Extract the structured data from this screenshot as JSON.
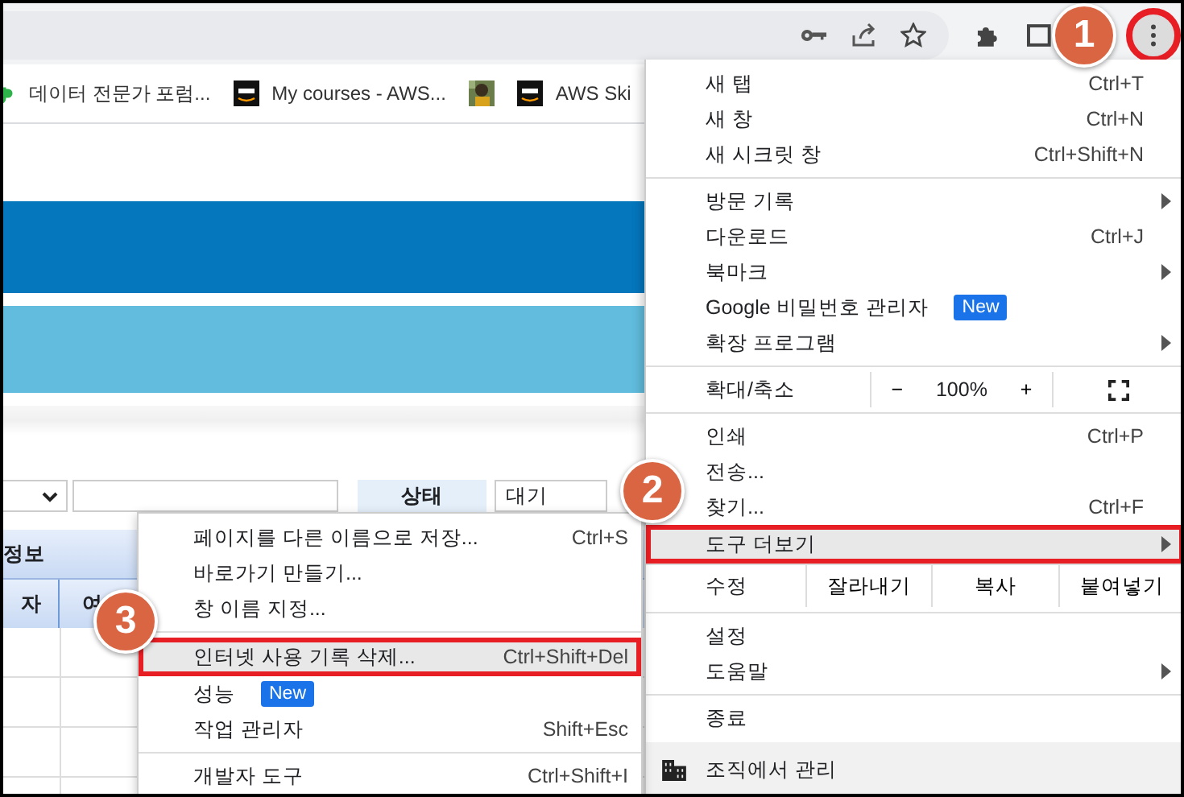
{
  "toolbar": {
    "menu_button": {
      "highlighted": true,
      "callout": "1"
    }
  },
  "bookmarks": [
    {
      "label": "데이터 전문가 포럼..."
    },
    {
      "label": "My courses - AWS..."
    },
    {
      "label": "AWS Ski"
    }
  ],
  "form": {
    "status_header": "상태",
    "status_value": "대기"
  },
  "table": {
    "group_header": "정보",
    "columns": [
      "자",
      "여"
    ]
  },
  "menu": {
    "items": [
      {
        "kind": "item",
        "label": "새 탭",
        "shortcut": "Ctrl+T",
        "submenu": false,
        "selected": false
      },
      {
        "kind": "item",
        "label": "새 창",
        "shortcut": "Ctrl+N",
        "submenu": false,
        "selected": false
      },
      {
        "kind": "item",
        "label": "새 시크릿 창",
        "shortcut": "Ctrl+Shift+N",
        "submenu": false,
        "selected": false
      },
      {
        "kind": "divider"
      },
      {
        "kind": "item",
        "label": "방문 기록",
        "submenu": true,
        "selected": false
      },
      {
        "kind": "item",
        "label": "다운로드",
        "shortcut": "Ctrl+J",
        "submenu": false,
        "selected": false
      },
      {
        "kind": "item",
        "label": "북마크",
        "submenu": true,
        "selected": false
      },
      {
        "kind": "item",
        "label": "Google 비밀번호 관리자",
        "badge": "New",
        "submenu": false,
        "selected": false
      },
      {
        "kind": "item",
        "label": "확장 프로그램",
        "submenu": true,
        "selected": false
      },
      {
        "kind": "divider"
      },
      {
        "kind": "zoom",
        "label": "확대/축소",
        "minus": "−",
        "value": "100%",
        "plus": "+"
      },
      {
        "kind": "divider"
      },
      {
        "kind": "item",
        "label": "인쇄",
        "shortcut": "Ctrl+P",
        "submenu": false,
        "selected": false
      },
      {
        "kind": "item",
        "label": "전송...",
        "submenu": false,
        "selected": false
      },
      {
        "kind": "item",
        "label": "찾기...",
        "shortcut": "Ctrl+F",
        "submenu": false,
        "selected": false
      },
      {
        "kind": "item",
        "label": "도구 더보기",
        "submenu": true,
        "selected": true,
        "callout": "2"
      },
      {
        "kind": "edit",
        "label": "수정",
        "actions": [
          "잘라내기",
          "복사",
          "붙여넣기"
        ]
      },
      {
        "kind": "divider"
      },
      {
        "kind": "item",
        "label": "설정",
        "submenu": false,
        "selected": false
      },
      {
        "kind": "item",
        "label": "도움말",
        "submenu": true,
        "selected": false
      },
      {
        "kind": "divider"
      },
      {
        "kind": "item",
        "label": "종료",
        "submenu": false,
        "selected": false
      },
      {
        "kind": "managed",
        "label": "조직에서 관리"
      }
    ]
  },
  "submenu": {
    "items": [
      {
        "kind": "item",
        "label": "페이지를 다른 이름으로 저장...",
        "shortcut": "Ctrl+S",
        "selected": false
      },
      {
        "kind": "item",
        "label": "바로가기 만들기...",
        "selected": false
      },
      {
        "kind": "item",
        "label": "창 이름 지정...",
        "selected": false
      },
      {
        "kind": "divider"
      },
      {
        "kind": "item",
        "label": "인터넷 사용 기록 삭제...",
        "shortcut": "Ctrl+Shift+Del",
        "selected": true,
        "callout": "3"
      },
      {
        "kind": "item",
        "label": "성능",
        "badge": "New",
        "selected": false
      },
      {
        "kind": "item",
        "label": "작업 관리자",
        "shortcut": "Shift+Esc",
        "selected": false
      },
      {
        "kind": "divider"
      },
      {
        "kind": "item",
        "label": "개발자 도구",
        "shortcut": "Ctrl+Shift+I",
        "selected": false
      }
    ]
  }
}
